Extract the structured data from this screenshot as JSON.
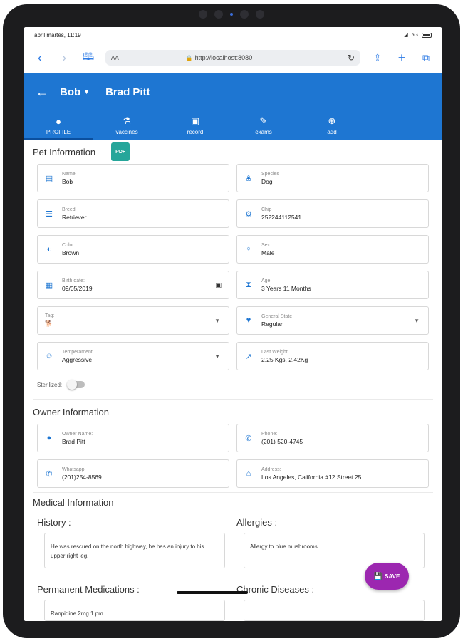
{
  "status_bar": {
    "time": "abril martes, 11:19",
    "signal": "5G"
  },
  "browser": {
    "aa": "AA",
    "url": "http://localhost:8080"
  },
  "header": {
    "pet_name": "Bob",
    "owner_name": "Brad Pitt"
  },
  "tabs": [
    {
      "label": "PROFILE",
      "icon": "person-icon"
    },
    {
      "label": "vaccines",
      "icon": "syringe-icon"
    },
    {
      "label": "record",
      "icon": "book-icon"
    },
    {
      "label": "exams",
      "icon": "pen-icon"
    },
    {
      "label": "add",
      "icon": "plus-circle-icon"
    }
  ],
  "pet_info": {
    "title": "Pet Information",
    "pdf_label": "PDF",
    "name": {
      "label": "Name:",
      "value": "Bob"
    },
    "species": {
      "label": "Species",
      "value": "Dog"
    },
    "breed": {
      "label": "Breed",
      "value": "Retriever"
    },
    "chip": {
      "label": "Chip",
      "value": "252244112541"
    },
    "color": {
      "label": "Color",
      "value": "Brown"
    },
    "sex": {
      "label": "Sex:",
      "value": "Male"
    },
    "birth_date": {
      "label": "Birth date:",
      "value": "09/05/2019"
    },
    "age": {
      "label": "Age:",
      "value": "3 Years 11 Months"
    },
    "tag": {
      "label": "Tag:"
    },
    "general_state": {
      "label": "General State",
      "value": "Regular"
    },
    "temperament": {
      "label": "Temperament",
      "value": "Aggressive"
    },
    "last_weight": {
      "label": "Last Weight",
      "value": "2.25 Kgs, 2.42Kg"
    },
    "sterilized_label": "Sterilized:"
  },
  "owner_info": {
    "title": "Owner Information",
    "owner_name": {
      "label": "Owner Name:",
      "value": "Brad Pitt"
    },
    "phone": {
      "label": "Phone:",
      "value": "(201) 520-4745"
    },
    "whatsapp": {
      "label": "Whatsapp:",
      "value": "(201)254-8569"
    },
    "address": {
      "label": "Address:",
      "value": "Los Angeles, California #12 Street 25"
    }
  },
  "medical_info": {
    "title": "Medical Information",
    "history_title": "History :",
    "history_text": "He was rescued on the north highway, he has an injury to his upper right leg.",
    "allergies_title": "Allergies :",
    "allergies_text": "Allergy to blue mushrooms",
    "permanent_medications_title": "Permanent Medications :",
    "permanent_medications_text": "Ranpidine 2mg 1 pm",
    "chronic_diseases_title": "Chronic Diseases :"
  },
  "save_button": {
    "label": "SAVE"
  }
}
